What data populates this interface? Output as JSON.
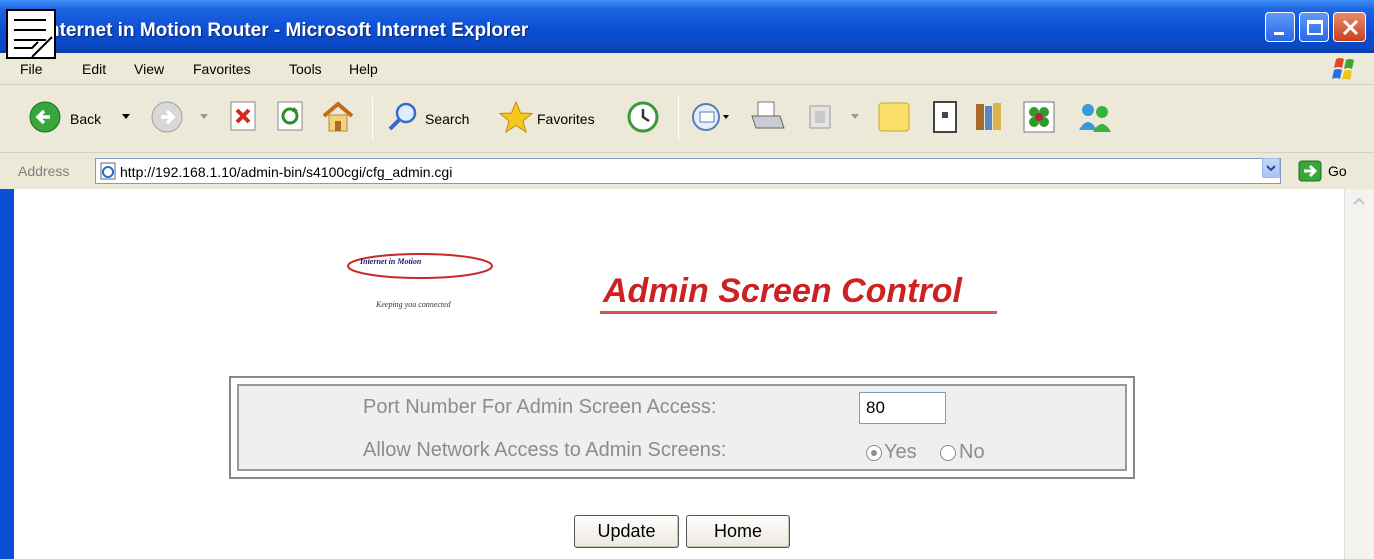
{
  "window": {
    "title": "nternet in Motion Router - Microsoft Internet Explorer",
    "icons": [
      "document-icon",
      "minimize-icon",
      "maximize-icon",
      "close-icon"
    ]
  },
  "menu": {
    "items": [
      "File",
      "Edit",
      "View",
      "Favorites",
      "Tools",
      "Help"
    ]
  },
  "toolbar": {
    "back_label": "Back",
    "search_label": "Search",
    "favorites_label": "Favorites",
    "icons": [
      "back-icon",
      "forward-icon",
      "stop-icon",
      "refresh-icon",
      "home-icon",
      "search-icon",
      "favorites-icon",
      "history-icon",
      "mail-icon",
      "print-icon",
      "edit-icon",
      "discuss-icon",
      "research-icon",
      "media-icon",
      "messenger-icon"
    ]
  },
  "address": {
    "label": "Address",
    "url": "http://192.168.1.10/admin-bin/s4100cgi/cfg_admin.cgi",
    "go_label": "Go"
  },
  "page": {
    "logo_text": "Internet in Motion",
    "logo_tagline": "Keeping you connected",
    "heading": "Admin Screen Control",
    "port_label": "Port Number For Admin Screen Access:",
    "port_value": "80",
    "network_label": "Allow Network Access to Admin Screens:",
    "yes_label": "Yes",
    "no_label": "No",
    "selected_option": "Yes",
    "update_label": "Update",
    "home_label": "Home"
  },
  "colors": {
    "title_bar": "#0a4fd6",
    "heading": "#cc2222",
    "form_text": "#8c8c8c"
  }
}
